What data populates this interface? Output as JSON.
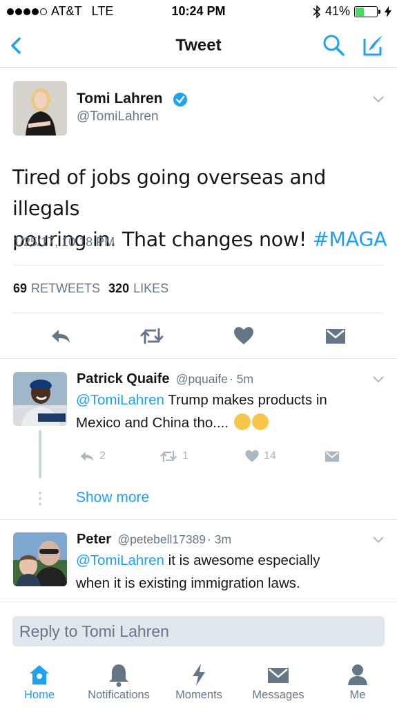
{
  "status_bar": {
    "carrier": "AT&T",
    "network": "LTE",
    "time": "10:24 PM",
    "battery_percent": "41%",
    "battery_level": 0.41
  },
  "nav": {
    "title": "Tweet",
    "icons": [
      "back-chevron-icon",
      "search-icon",
      "compose-icon"
    ]
  },
  "tweet": {
    "author_name": "Tomi Lahren",
    "author_handle": "@TomiLahren",
    "text_line1": "Tired of jobs going overseas and illegals",
    "text_line2": "pouring in. That changes now! ",
    "hashtag": "#MAGA",
    "date": "1/25/17, 10:18 PM",
    "retweets_count": "69",
    "retweets_label": "RETWEETS",
    "likes_count": "320",
    "likes_label": "LIKES"
  },
  "replies": [
    {
      "name": "Patrick Quaife",
      "handle": "@pquaife",
      "time": "· 5m",
      "mention": "@TomiLahren",
      "text_line1": " Trump makes products in",
      "text_line2": "Mexico and China tho.... ",
      "reply_count": "2",
      "retweet_count": "1",
      "like_count": "14"
    },
    {
      "name": "Peter",
      "handle": "@petebell17389",
      "time": "· 3m",
      "mention": "@TomiLahren",
      "text_line1": " it is awesome especially",
      "text_line2": "when it is existing immigration laws."
    }
  ],
  "show_more": "Show more",
  "reply_box": {
    "placeholder": "Reply to Tomi Lahren"
  },
  "tabbar": {
    "active": "Home",
    "items": [
      {
        "label": "Home",
        "icon": "home-icon"
      },
      {
        "label": "Notifications",
        "icon": "bell-icon"
      },
      {
        "label": "Moments",
        "icon": "lightning-icon"
      },
      {
        "label": "Messages",
        "icon": "envelope-icon"
      },
      {
        "label": "Me",
        "icon": "person-icon"
      }
    ]
  },
  "colors": {
    "accent": "#1da1f2",
    "text": "#14171a",
    "secondary": "#657786",
    "muted_icon": "#aab8c2"
  }
}
